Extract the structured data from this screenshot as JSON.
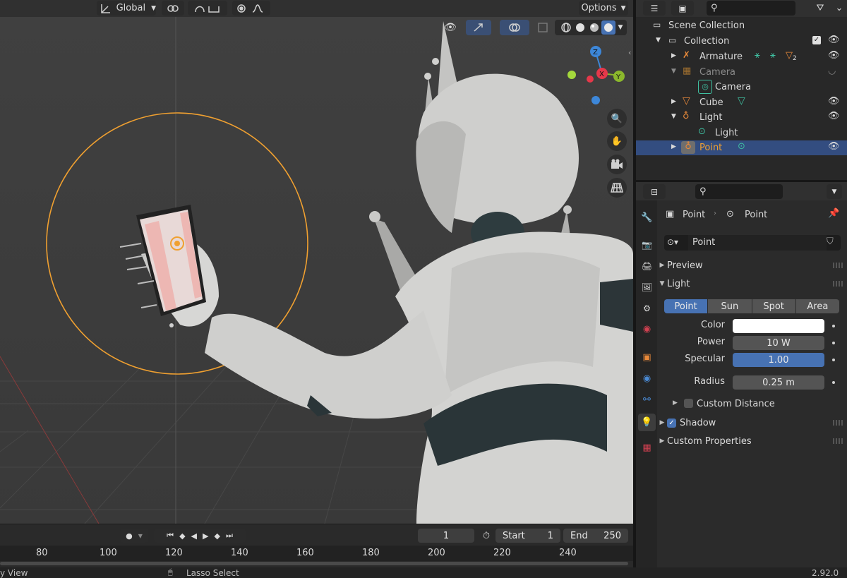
{
  "viewport_header": {
    "orientation": "Global",
    "options": "Options"
  },
  "gizmo": {
    "z": "Z",
    "x": "X",
    "y": "Y"
  },
  "timeline": {
    "current_frame": "1",
    "start_label": "Start",
    "start_value": "1",
    "end_label": "End",
    "end_value": "250",
    "ruler": [
      "80",
      "100",
      "120",
      "140",
      "160",
      "180",
      "200",
      "220",
      "240"
    ]
  },
  "statusbar": {
    "left": "y View",
    "middle": "Lasso Select",
    "version": "2.92.0"
  },
  "outliner": {
    "rows": [
      {
        "label": "Scene Collection"
      },
      {
        "label": "Collection"
      },
      {
        "label": "Armature",
        "badge": "2"
      },
      {
        "label": "Camera"
      },
      {
        "label": "Camera"
      },
      {
        "label": "Cube"
      },
      {
        "label": "Light"
      },
      {
        "label": "Light"
      },
      {
        "label": "Point"
      }
    ]
  },
  "properties": {
    "breadcrumb": [
      "Point",
      "Point"
    ],
    "datablock_name": "Point",
    "panels": {
      "preview": "Preview",
      "light": "Light",
      "custom_distance": "Custom Distance",
      "shadow": "Shadow",
      "custom_properties": "Custom Properties"
    },
    "light_types": [
      "Point",
      "Sun",
      "Spot",
      "Area"
    ],
    "active_type_index": 0,
    "fields": {
      "color_label": "Color",
      "color_value": "#ffffff",
      "power_label": "Power",
      "power_value": "10 W",
      "specular_label": "Specular",
      "specular_value": "1.00",
      "radius_label": "Radius",
      "radius_value": "0.25 m"
    },
    "shadow_checked": true,
    "custom_distance_checked": false
  },
  "colors": {
    "accent_blue": "#4772b3",
    "selection_row": "#334d80",
    "light_circle": "#f0a030",
    "axis_x": "#e5384a",
    "axis_y": "#8bb82c",
    "axis_z": "#3d87d9"
  }
}
